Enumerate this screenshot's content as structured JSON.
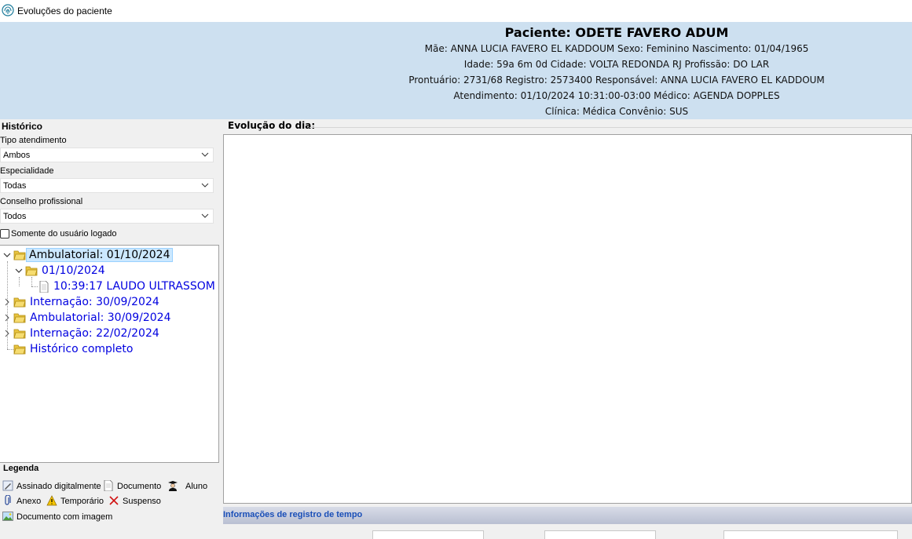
{
  "window": {
    "title": "Evoluções do paciente",
    "icon": "fingerprint-icon"
  },
  "header": {
    "patient": "Paciente: ODETE FAVERO ADUM",
    "line1": "Mãe: ANNA LUCIA FAVERO EL KADDOUM  Sexo: Feminino  Nascimento: 01/04/1965",
    "line2": "Idade: 59a 6m 0d  Cidade: VOLTA REDONDA RJ  Profissão: DO LAR",
    "line3": "Prontuário: 2731/68  Registro: 2573400  Responsável: ANNA LUCIA FAVERO EL KADDOUM",
    "line4": "Atendimento: 01/10/2024 10:31:00-03:00  Médico: AGENDA DOPPLES",
    "line5": "Clínica: Médica  Convênio: SUS",
    "bg_color": "#cde0f0"
  },
  "historico": {
    "title": "Histórico",
    "tipo_label": "Tipo atendimento",
    "tipo_value": "Ambos",
    "especialidade_label": "Especialidade",
    "especialidade_value": "Todas",
    "conselho_label": "Conselho profissional",
    "conselho_value": "Todos",
    "checkbox_label": "Somente do usuário logado",
    "checkbox_checked": false
  },
  "tree": {
    "nodes": [
      {
        "label": "Ambulatorial: 01/10/2024",
        "icon": "folder-open-icon",
        "expanded": true,
        "selected": true
      },
      {
        "label": "01/10/2024",
        "icon": "folder-open-icon",
        "expanded": true
      },
      {
        "label": "10:39:17 LAUDO ULTRASSOM",
        "icon": "document-icon"
      },
      {
        "label": "Internação: 30/09/2024",
        "icon": "folder-open-icon",
        "expanded": false
      },
      {
        "label": "Ambulatorial: 30/09/2024",
        "icon": "folder-open-icon",
        "expanded": false
      },
      {
        "label": "Internação: 22/02/2024",
        "icon": "folder-open-icon",
        "expanded": false
      },
      {
        "label": "Histórico completo",
        "icon": "folder-open-icon"
      }
    ],
    "link_color": "#0000e0"
  },
  "legenda": {
    "title": "Legenda",
    "assinado": "Assinado digitalmente",
    "documento": "Documento",
    "aluno": "Aluno",
    "anexo": "Anexo",
    "temporario": "Temporário",
    "suspenso": "Suspenso",
    "doc_imagem": "Documento com imagem"
  },
  "evolucao": {
    "title": "Evolução do dia:",
    "content": "",
    "time_info": "Informações de registro de tempo"
  }
}
